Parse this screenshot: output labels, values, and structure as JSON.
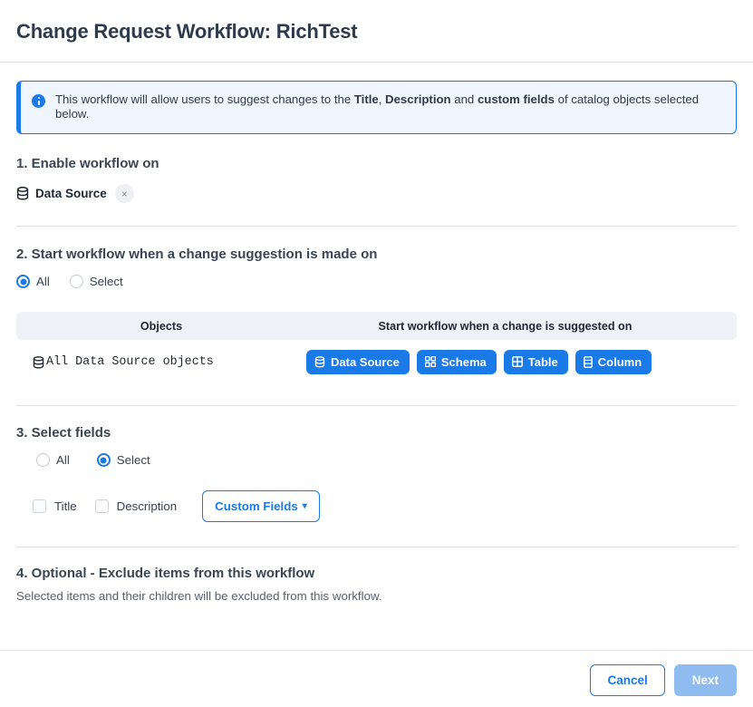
{
  "header": {
    "title": "Change Request Workflow: RichTest"
  },
  "banner": {
    "icon": "info-circle-icon",
    "text_part1": "This workflow will allow users to suggest changes to the ",
    "bold1": "Title",
    "text_part2": ", ",
    "bold2": "Description",
    "text_part3": " and ",
    "bold3": "custom fields",
    "text_part4": " of catalog objects selected below."
  },
  "section1": {
    "title": "1. Enable workflow on",
    "chip": {
      "icon": "database-icon",
      "label": "Data Source",
      "close": "×"
    }
  },
  "section2": {
    "title": "2. Start workflow when a change suggestion is made on",
    "radios": [
      {
        "label": "All",
        "selected": true
      },
      {
        "label": "Select",
        "selected": false
      }
    ],
    "table": {
      "headers": [
        "Objects",
        "Start workflow when a change is suggested on"
      ],
      "row": {
        "object_icon": "database-icon",
        "object_label": "All Data Source objects",
        "pills": [
          {
            "icon": "database-icon",
            "label": "Data Source"
          },
          {
            "icon": "schema-grid-icon",
            "label": "Schema"
          },
          {
            "icon": "table-grid-icon",
            "label": "Table"
          },
          {
            "icon": "column-icon",
            "label": "Column"
          }
        ]
      }
    }
  },
  "section3": {
    "title": "3. Select fields",
    "radios": [
      {
        "label": "All",
        "selected": false
      },
      {
        "label": "Select",
        "selected": true
      }
    ],
    "checkboxes": [
      {
        "label": "Title",
        "checked": false
      },
      {
        "label": "Description",
        "checked": false
      }
    ],
    "custom_fields_button": {
      "label": "Custom Fields",
      "icon": "chevron-down-icon"
    }
  },
  "section4": {
    "title": "4. Optional - Exclude items from this workflow",
    "subtitle": "Selected items and their children will be excluded from this workflow."
  },
  "footer": {
    "cancel_label": "Cancel",
    "next_label": "Next",
    "next_disabled": true
  },
  "colors": {
    "accent_blue": "#1a7ae8",
    "banner_bg": "#eff6fd",
    "table_header_bg": "#eef1f6",
    "next_disabled_bg": "#8fbcf0",
    "text_dark": "#26303e"
  }
}
